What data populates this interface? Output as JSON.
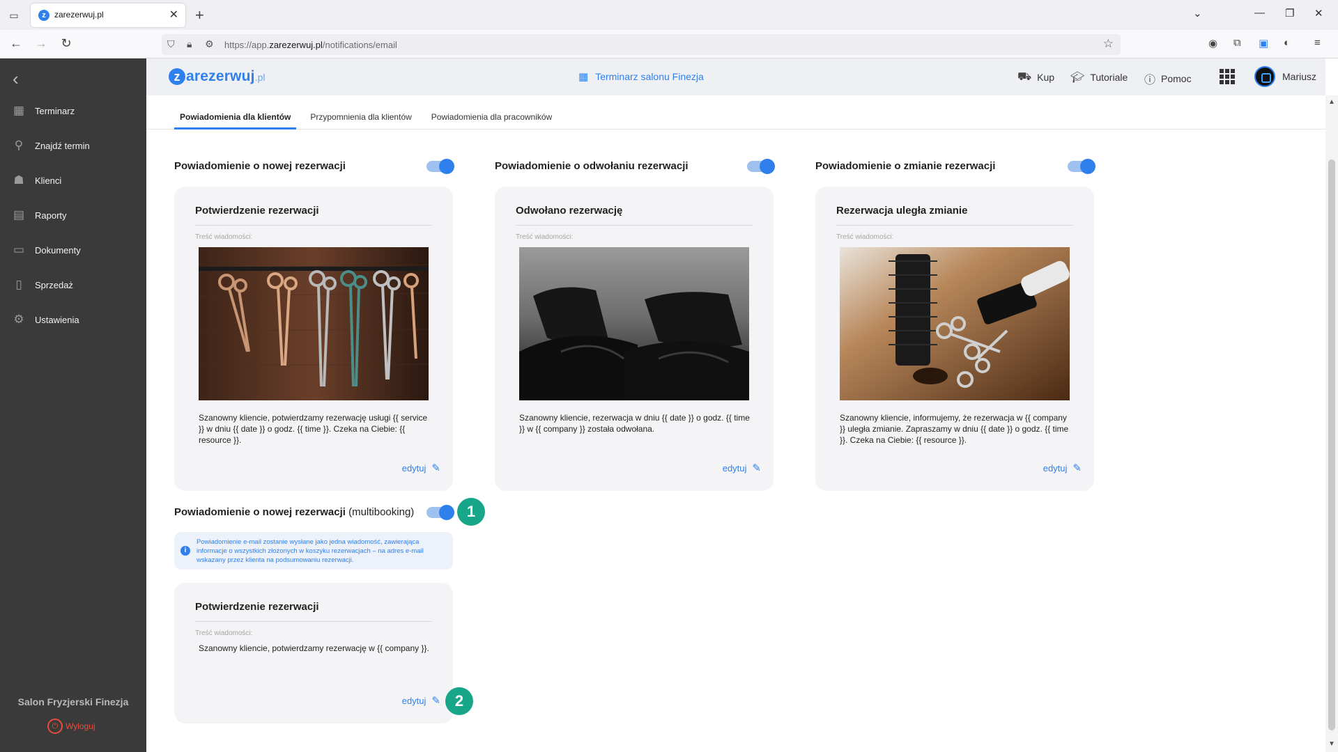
{
  "browser": {
    "tab_title": "zarezerwuj.pl",
    "url_prefix": "https://app.",
    "url_domain": "zarezerwuj.pl",
    "url_path": "/notifications/email"
  },
  "app": {
    "logo_text": "arezerwuj",
    "logo_suffix": ".pl",
    "calendar_name": "Terminarz salonu Finezja",
    "header_links": {
      "buy": "Kup",
      "tutorials": "Tutoriale",
      "help": "Pomoc"
    },
    "user_name": "Mariusz"
  },
  "sidebar": {
    "items": [
      {
        "label": "Terminarz",
        "icon": "calendar-icon"
      },
      {
        "label": "Znajdź termin",
        "icon": "search-icon"
      },
      {
        "label": "Klienci",
        "icon": "users-icon"
      },
      {
        "label": "Raporty",
        "icon": "report-icon"
      },
      {
        "label": "Dokumenty",
        "icon": "folder-icon"
      },
      {
        "label": "Sprzedaż",
        "icon": "document-icon"
      },
      {
        "label": "Ustawienia",
        "icon": "gear-icon"
      }
    ],
    "salon_name": "Salon Fryzjerski Finezja",
    "logout_label": "Wyloguj"
  },
  "tabs": [
    {
      "label": "Powiadomienia dla klientów",
      "active": true
    },
    {
      "label": "Przypomnienia dla klientów",
      "active": false
    },
    {
      "label": "Powiadomienia dla pracowników",
      "active": false
    }
  ],
  "sections": [
    {
      "title": "Powiadomienie o nowej rezerwacji",
      "enabled": true,
      "card_title": "Potwierdzenie rezerwacji",
      "content_label": "Treść wiadomości:",
      "message": "Szanowny kliencie,  potwierdzamy rezerwację usługi {{ service }}  w dniu {{ date }} o godz. {{ time }}. Czeka na Ciebie: {{ resource }}.",
      "edit_label": "edytuj"
    },
    {
      "title": "Powiadomienie o odwołaniu rezerwacji",
      "enabled": true,
      "card_title": "Odwołano rezerwację",
      "content_label": "Treść wiadomości:",
      "message": "Szanowny kliencie,  rezerwacja w dniu {{ date }} o godz. {{ time }} w {{ company }} została odwołana.",
      "edit_label": "edytuj"
    },
    {
      "title": "Powiadomienie o zmianie rezerwacji",
      "enabled": true,
      "card_title": "Rezerwacja uległa zmianie",
      "content_label": "Treść wiadomości:",
      "message": "Szanowny kliencie,  informujemy, że rezerwacja w {{ company }} uległa zmianie. Zapraszamy w dniu {{ date }} o godz. {{ time }}. Czeka na Ciebie: {{ resource }}.",
      "edit_label": "edytuj"
    }
  ],
  "multibooking": {
    "title": "Powiadomienie o nowej rezerwacji",
    "title_suffix": "(multibooking)",
    "enabled": true,
    "info": "Powiadomienie e-mail zostanie wysłane jako jedna wiadomość, zawierająca informacje o wszystkich złożonych w koszyku rezerwacjach – na adres e-mail wskazany przez klienta na podsumowaniu rezerwacji.",
    "card_title": "Potwierdzenie rezerwacji",
    "content_label": "Treść wiadomości:",
    "message": "Szanowny kliencie, potwierdzamy rezerwację w {{ company }}.",
    "edit_label": "edytuj"
  },
  "badges": {
    "first": "1",
    "second": "2"
  },
  "colors": {
    "accent": "#2f80ed",
    "sidebar_bg": "#3a3a3a",
    "badge": "#17a689",
    "logout": "#e74c3c"
  }
}
